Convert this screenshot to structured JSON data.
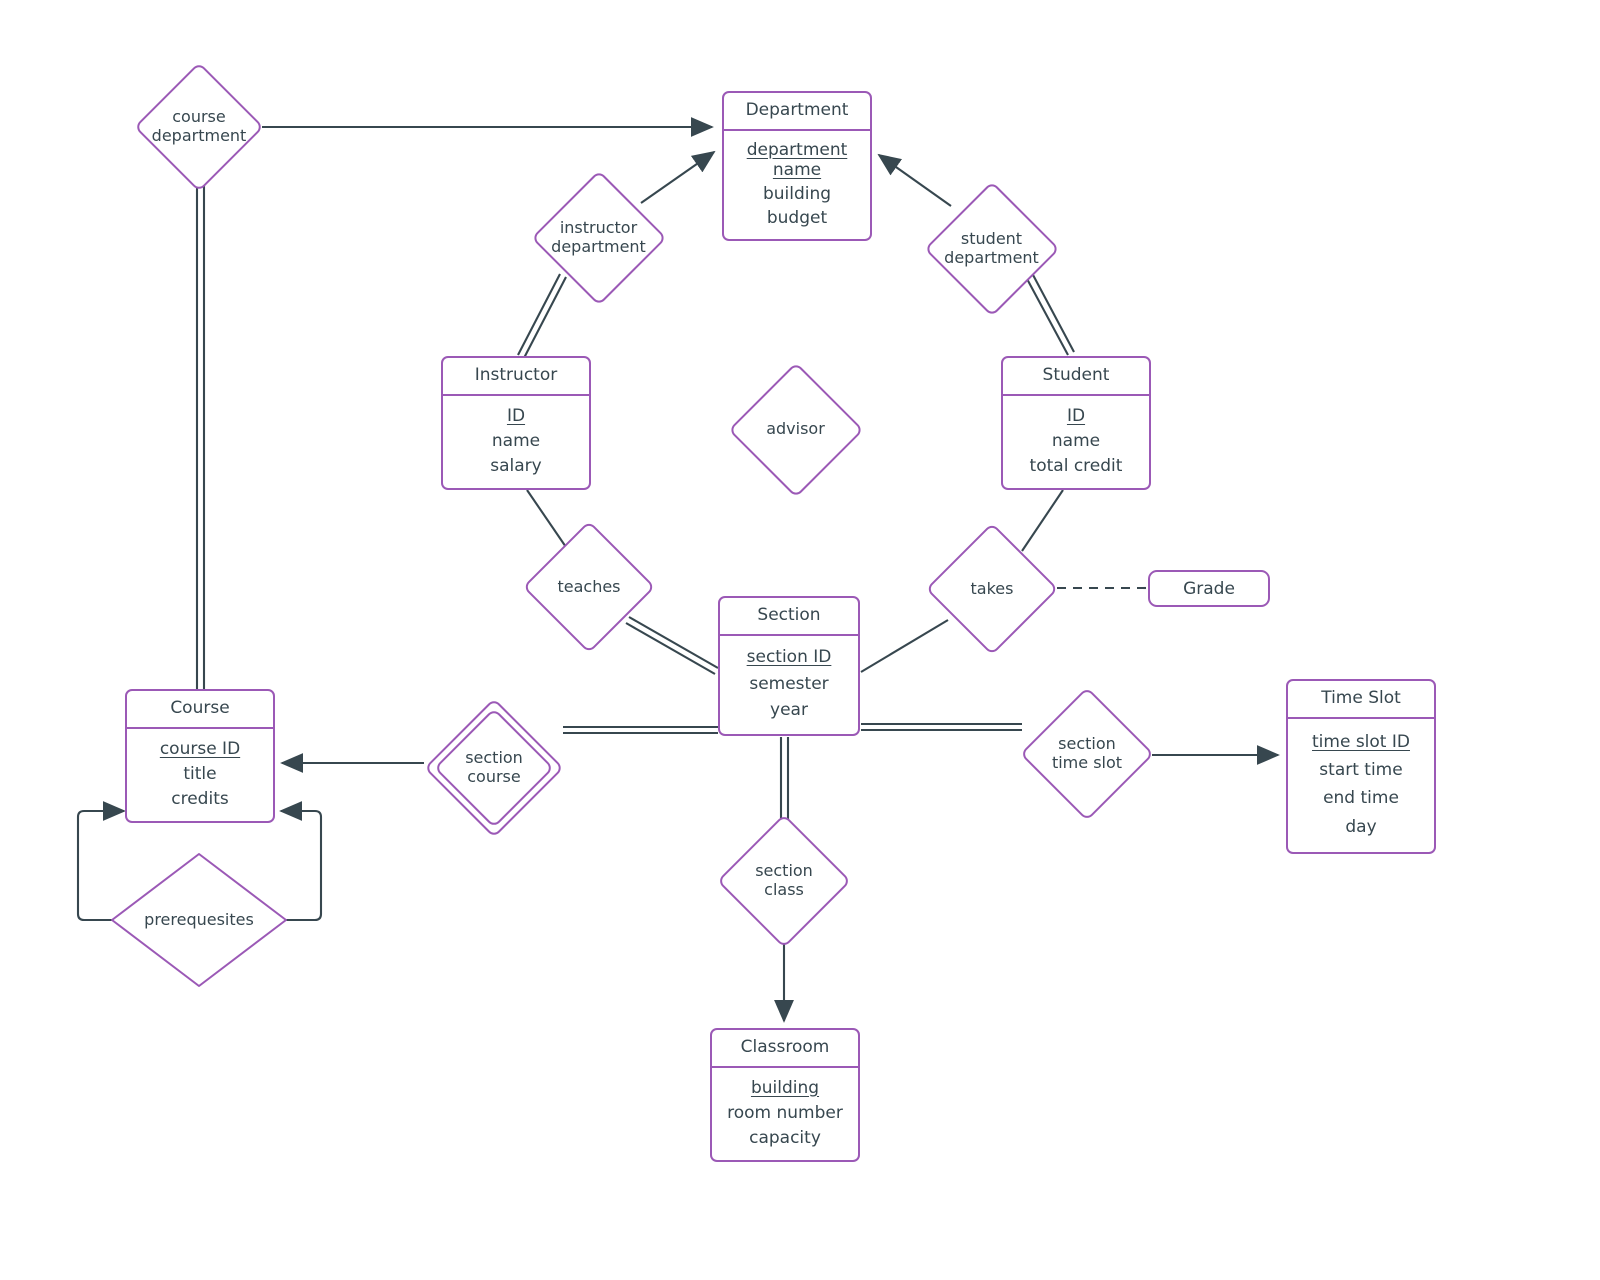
{
  "diagram": {
    "type": "er-diagram",
    "title": "University Schema ER Diagram",
    "palette": {
      "shape_border": "#9b59b6",
      "line": "#37474f",
      "text": "#37474f",
      "background": "#ffffff"
    }
  },
  "entities": [
    {
      "id": "department",
      "name": "Department",
      "attributes": [
        {
          "label": "department name",
          "key": true
        },
        {
          "label": "building",
          "key": false
        },
        {
          "label": "budget",
          "key": false
        }
      ]
    },
    {
      "id": "instructor",
      "name": "Instructor",
      "attributes": [
        {
          "label": "ID",
          "key": true
        },
        {
          "label": "name",
          "key": false
        },
        {
          "label": "salary",
          "key": false
        }
      ]
    },
    {
      "id": "student",
      "name": "Student",
      "attributes": [
        {
          "label": "ID",
          "key": true
        },
        {
          "label": "name",
          "key": false
        },
        {
          "label": "total credit",
          "key": false
        }
      ]
    },
    {
      "id": "section",
      "name": "Section",
      "attributes": [
        {
          "label": "section ID",
          "key": true
        },
        {
          "label": "semester",
          "key": false
        },
        {
          "label": "year",
          "key": false
        }
      ]
    },
    {
      "id": "course",
      "name": "Course",
      "attributes": [
        {
          "label": "course ID",
          "key": true
        },
        {
          "label": "title",
          "key": false
        },
        {
          "label": "credits",
          "key": false
        }
      ]
    },
    {
      "id": "timeslot",
      "name": "Time Slot",
      "attributes": [
        {
          "label": "time slot ID",
          "key": true
        },
        {
          "label": "start time",
          "key": false
        },
        {
          "label": "end time",
          "key": false
        },
        {
          "label": "day",
          "key": false
        }
      ]
    },
    {
      "id": "classroom",
      "name": "Classroom",
      "attributes": [
        {
          "label": "building",
          "key": true
        },
        {
          "label": "room number",
          "key": false
        },
        {
          "label": "capacity",
          "key": false
        }
      ]
    }
  ],
  "relationships": [
    {
      "id": "course-department",
      "label": "course\ndepartment",
      "identifying": false
    },
    {
      "id": "instructor-department",
      "label": "instructor\ndepartment",
      "identifying": false
    },
    {
      "id": "student-department",
      "label": "student\ndepartment",
      "identifying": false
    },
    {
      "id": "advisor",
      "label": "advisor",
      "identifying": false
    },
    {
      "id": "teaches",
      "label": "teaches",
      "identifying": false
    },
    {
      "id": "takes",
      "label": "takes",
      "identifying": false
    },
    {
      "id": "section-course",
      "label": "section\ncourse",
      "identifying": true
    },
    {
      "id": "section-time-slot",
      "label": "section\ntime slot",
      "identifying": false
    },
    {
      "id": "section-class",
      "label": "section\nclass",
      "identifying": false
    },
    {
      "id": "prerequesites",
      "label": "prerequesites",
      "identifying": false
    }
  ],
  "attribute_boxes": [
    {
      "id": "grade",
      "label": "Grade",
      "attached_to": "takes",
      "style": "dashed"
    }
  ],
  "labels": {
    "department": "Department",
    "department_attr_1": "department name",
    "department_attr_2": "building",
    "department_attr_3": "budget",
    "instructor": "Instructor",
    "instructor_attr_1": "ID",
    "instructor_attr_2": "name",
    "instructor_attr_3": "salary",
    "student": "Student",
    "student_attr_1": "ID",
    "student_attr_2": "name",
    "student_attr_3": "total credit",
    "section": "Section",
    "section_attr_1": "section ID",
    "section_attr_2": "semester",
    "section_attr_3": "year",
    "course": "Course",
    "course_attr_1": "course ID",
    "course_attr_2": "title",
    "course_attr_3": "credits",
    "timeslot": "Time Slot",
    "timeslot_attr_1": "time slot ID",
    "timeslot_attr_2": "start time",
    "timeslot_attr_3": "end time",
    "timeslot_attr_4": "day",
    "classroom": "Classroom",
    "classroom_attr_1": "building",
    "classroom_attr_2": "room number",
    "classroom_attr_3": "capacity",
    "rel_course_department_1": "course",
    "rel_course_department_2": "department",
    "rel_instructor_department_1": "instructor",
    "rel_instructor_department_2": "department",
    "rel_student_department_1": "student",
    "rel_student_department_2": "department",
    "rel_advisor": "advisor",
    "rel_teaches": "teaches",
    "rel_takes": "takes",
    "rel_section_course_1": "section",
    "rel_section_course_2": "course",
    "rel_section_time_slot_1": "section",
    "rel_section_time_slot_2": "time slot",
    "rel_section_class_1": "section",
    "rel_section_class_2": "class",
    "rel_prerequesites": "prerequesites",
    "attr_grade": "Grade"
  }
}
